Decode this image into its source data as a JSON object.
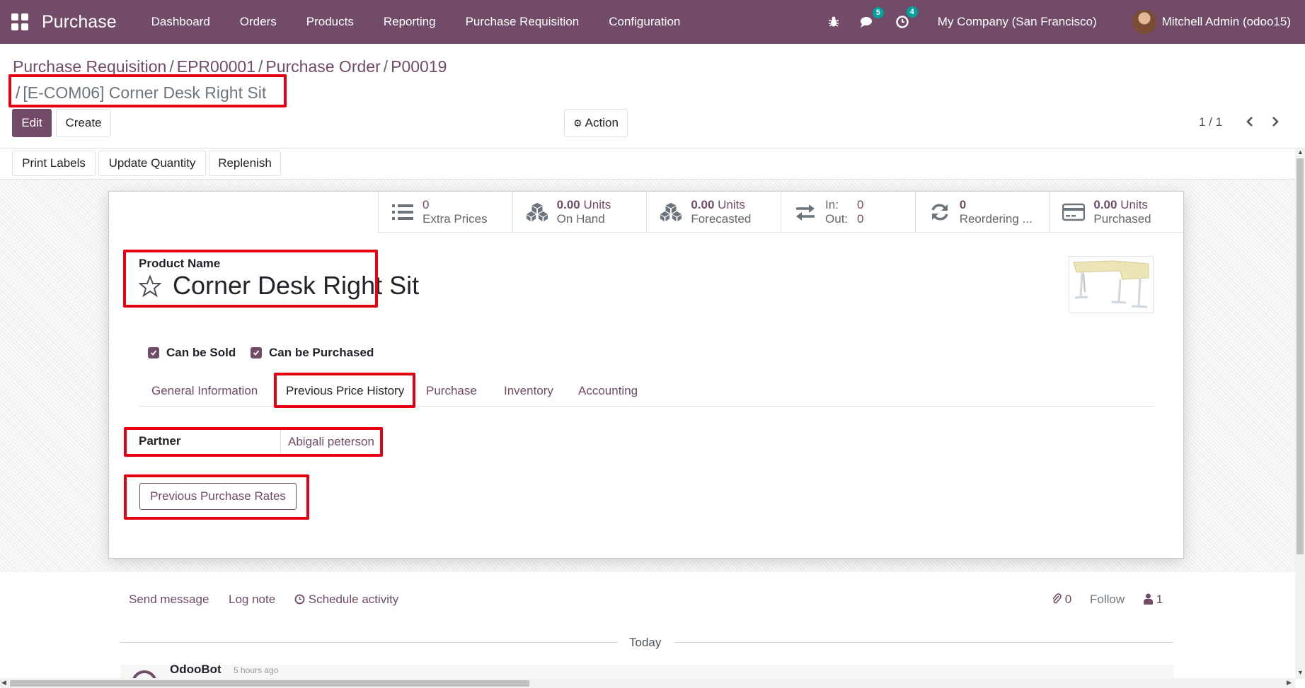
{
  "navbar": {
    "app_name": "Purchase",
    "menu": [
      "Dashboard",
      "Orders",
      "Products",
      "Reporting",
      "Purchase Requisition",
      "Configuration"
    ],
    "messages_count": "5",
    "activities_count": "4",
    "company": "My Company (San Francisco)",
    "user": "Mitchell Admin (odoo15)"
  },
  "breadcrumb": {
    "items": [
      "Purchase Requisition",
      "EPR00001",
      "Purchase Order",
      "P00019"
    ],
    "separator": "/",
    "active": "[E-COM06] Corner Desk Right Sit"
  },
  "buttons": {
    "edit": "Edit",
    "create": "Create",
    "action": "Action",
    "print_labels": "Print Labels",
    "update_quantity": "Update Quantity",
    "replenish": "Replenish"
  },
  "pager": {
    "value": "1 / 1"
  },
  "smart_buttons": {
    "extra_prices": {
      "value": "0",
      "label": "Extra Prices"
    },
    "on_hand": {
      "value": "0.00",
      "unit": "Units",
      "label": "On Hand"
    },
    "forecasted": {
      "value": "0.00",
      "unit": "Units",
      "label": "Forecasted"
    },
    "in_out": {
      "in_label": "In:",
      "in_value": "0",
      "out_label": "Out:",
      "out_value": "0"
    },
    "reordering": {
      "value": "0",
      "label": "Reordering ..."
    },
    "purchased": {
      "value": "0.00",
      "unit": "Units",
      "label": "Purchased"
    }
  },
  "product": {
    "name_label": "Product Name",
    "name": "Corner Desk Right Sit",
    "can_be_sold": "Can be Sold",
    "can_be_purchased": "Can be Purchased"
  },
  "tabs": [
    "General Information",
    "Previous Price History",
    "Purchase",
    "Inventory",
    "Accounting"
  ],
  "active_tab": "Previous Price History",
  "price_history": {
    "partner_label": "Partner",
    "partner_value": "Abigali peterson",
    "button": "Previous Purchase Rates"
  },
  "chatter": {
    "send_message": "Send message",
    "log_note": "Log note",
    "schedule_activity": "Schedule activity",
    "attachments": "0",
    "follow": "Follow",
    "followers": "1",
    "today": "Today",
    "author": "OdooBot",
    "time": "5 hours ago"
  },
  "colors": {
    "brand": "#714B67",
    "highlight": "#e60012",
    "badge": "#00A09D"
  }
}
